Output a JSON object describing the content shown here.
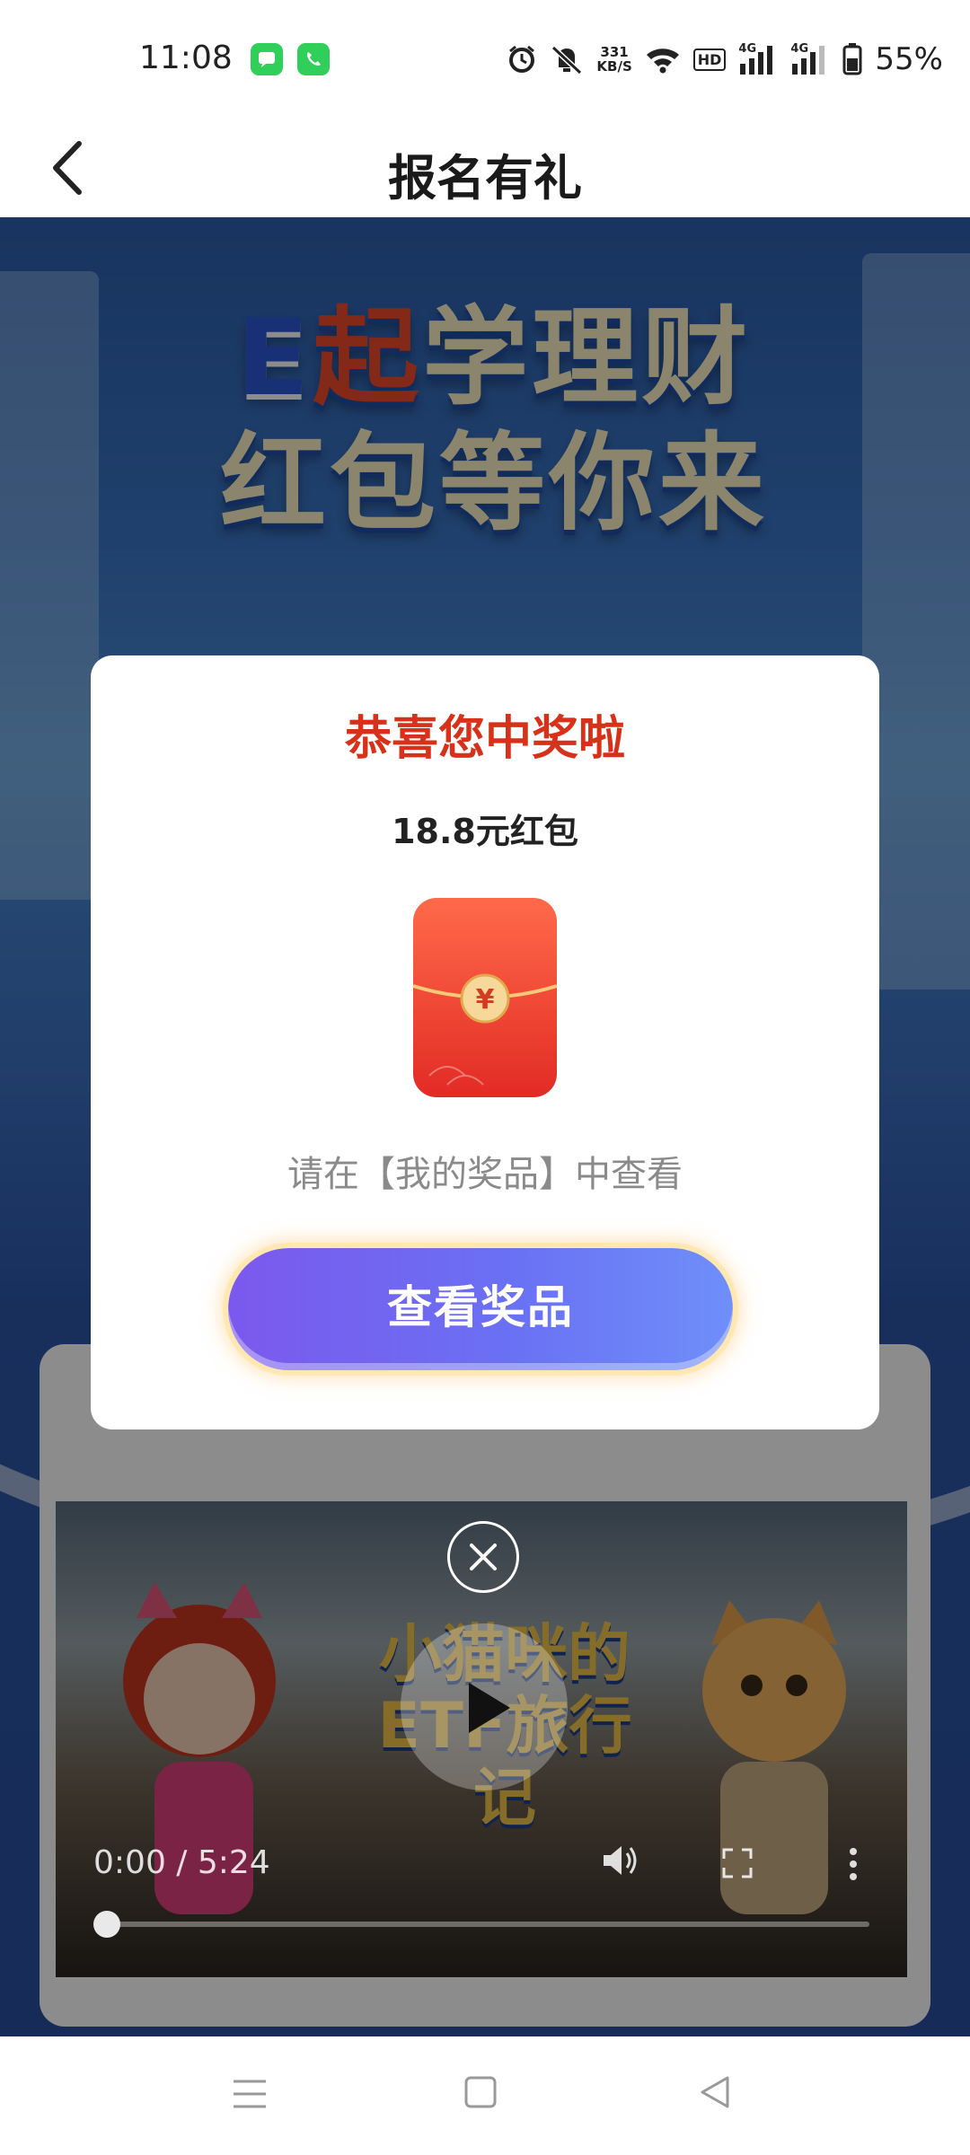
{
  "status_bar": {
    "time": "11:08",
    "net_speed_value": "331",
    "net_speed_unit": "KB/S",
    "hd_badge": "HD",
    "signal_1": "4G",
    "signal_2": "4G",
    "battery": "55%",
    "icons": [
      "messages-app-icon",
      "phone-app-icon",
      "alarm-icon",
      "mute-icon",
      "wifi-icon",
      "signal-icon",
      "battery-icon"
    ]
  },
  "header": {
    "title": "报名有礼"
  },
  "hero": {
    "line1_e": "E",
    "line1_qi": "起",
    "line1_rest": "学理财",
    "line2": "红包等你来"
  },
  "video": {
    "title": "小猫咪的ETF旅行记",
    "time": "0:00 / 5:24",
    "progress": 0
  },
  "modal": {
    "title": "恭喜您中奖啦",
    "prize": "18.8元红包",
    "envelope_symbol": "¥",
    "hint": "请在【我的奖品】中查看",
    "button_label": "查看奖品"
  },
  "colors": {
    "modal_title": "#d8311a",
    "button_start": "#7b59ee",
    "button_end": "#6f8ffa",
    "envelope": "#e8312a"
  }
}
